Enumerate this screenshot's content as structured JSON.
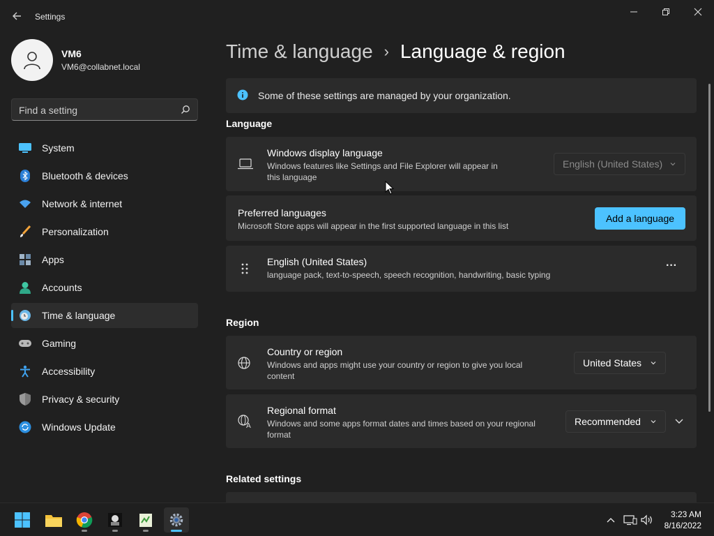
{
  "window": {
    "title": "Settings"
  },
  "profile": {
    "name": "VM6",
    "email": "VM6@collabnet.local"
  },
  "search": {
    "placeholder": "Find a setting"
  },
  "sidebar": {
    "items": [
      {
        "label": "System",
        "icon": "system-icon"
      },
      {
        "label": "Bluetooth & devices",
        "icon": "bluetooth-icon"
      },
      {
        "label": "Network & internet",
        "icon": "wifi-icon"
      },
      {
        "label": "Personalization",
        "icon": "brush-icon"
      },
      {
        "label": "Apps",
        "icon": "apps-icon"
      },
      {
        "label": "Accounts",
        "icon": "accounts-icon"
      },
      {
        "label": "Time & language",
        "icon": "clock-globe-icon",
        "active": true
      },
      {
        "label": "Gaming",
        "icon": "gamepad-icon"
      },
      {
        "label": "Accessibility",
        "icon": "accessibility-icon"
      },
      {
        "label": "Privacy & security",
        "icon": "shield-icon"
      },
      {
        "label": "Windows Update",
        "icon": "update-icon"
      }
    ]
  },
  "breadcrumb": {
    "parent": "Time & language",
    "separator": "›",
    "current": "Language & region"
  },
  "notice": {
    "text": "Some of these settings are managed by your organization."
  },
  "language": {
    "title": "Language",
    "display": {
      "title": "Windows display language",
      "subtitle": "Windows features like Settings and File Explorer will appear in this language",
      "value": "English (United States)"
    },
    "preferred": {
      "title": "Preferred languages",
      "subtitle": "Microsoft Store apps will appear in the first supported language in this list",
      "button": "Add a language"
    },
    "entry": {
      "title": "English (United States)",
      "subtitle": "language pack, text-to-speech, speech recognition, handwriting, basic typing",
      "more": "···"
    }
  },
  "region": {
    "title": "Region",
    "country": {
      "title": "Country or region",
      "subtitle": "Windows and apps might use your country or region to give you local content",
      "value": "United States"
    },
    "format": {
      "title": "Regional format",
      "subtitle": "Windows and some apps format dates and times based on your regional format",
      "value": "Recommended"
    }
  },
  "related": {
    "title": "Related settings"
  },
  "taskbar": {
    "time": "3:23 AM",
    "date": "8/16/2022"
  },
  "colors": {
    "accent": "#4cc2ff",
    "background": "#202020",
    "card": "#2b2b2b"
  }
}
